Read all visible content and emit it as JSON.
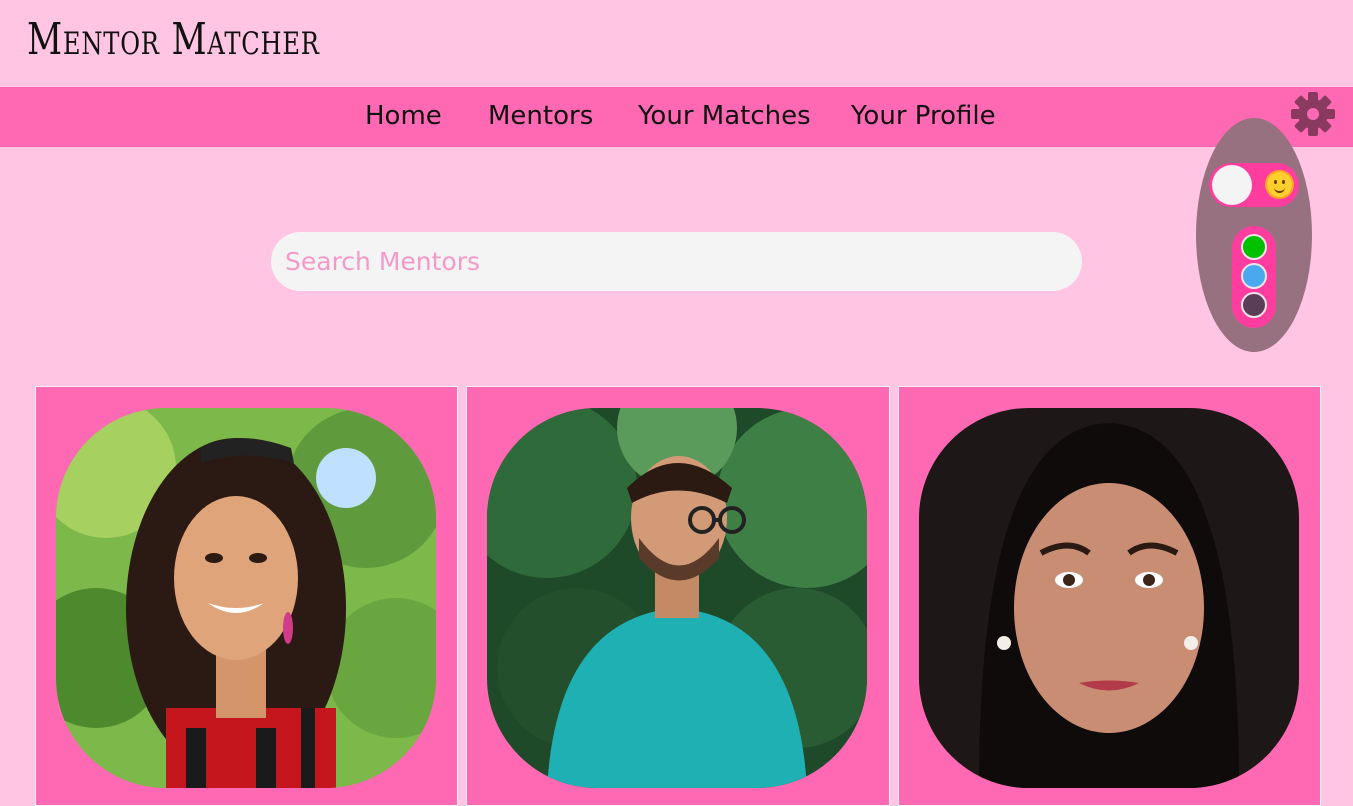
{
  "header": {
    "title": "Mentor Matcher"
  },
  "nav": {
    "items": [
      {
        "label": "Home"
      },
      {
        "label": "Mentors"
      },
      {
        "label": "Your Matches"
      },
      {
        "label": "Your Profile"
      }
    ]
  },
  "settings": {
    "icon": "gear-icon",
    "theme_toggle": {
      "state": "light",
      "icon": "sun-emoji-icon"
    },
    "color_swatches": [
      {
        "color": "#00c000"
      },
      {
        "color": "#4aa8f0"
      },
      {
        "color": "#5a3e58"
      }
    ]
  },
  "search": {
    "placeholder": "Search Mentors",
    "value": ""
  },
  "mentors": [
    {
      "photo": "mentor-photo-woman-red-plaid-shirt"
    },
    {
      "photo": "mentor-photo-man-teal-shirt-glasses"
    },
    {
      "photo": "mentor-photo-woman-dark-background"
    }
  ],
  "colors": {
    "background": "#ffc5e3",
    "navbar": "#ff69b4",
    "accent": "#ff3d9e"
  }
}
